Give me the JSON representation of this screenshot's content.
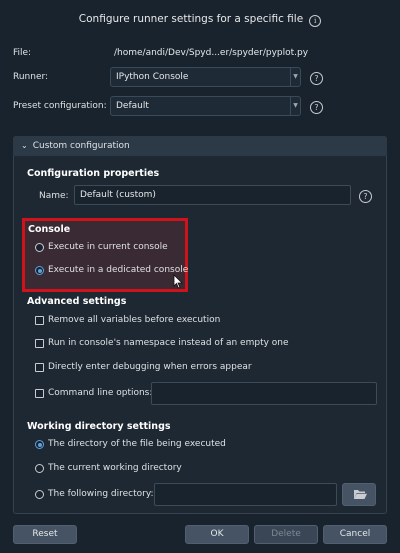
{
  "dialog": {
    "title": "Configure runner settings for a specific file"
  },
  "file": {
    "label": "File:",
    "value": "/home/andi/Dev/Spyd...er/spyder/pyplot.py"
  },
  "runner": {
    "label": "Runner:",
    "value": "IPython Console"
  },
  "preset": {
    "label": "Preset configuration:",
    "value": "Default"
  },
  "custom_config": {
    "header": "Custom configuration",
    "properties_title": "Configuration properties",
    "name_label": "Name:",
    "name_value": "Default (custom)"
  },
  "console": {
    "title": "Console",
    "options": [
      {
        "label": "Execute in current console",
        "selected": false
      },
      {
        "label": "Execute in a dedicated console",
        "selected": true
      }
    ]
  },
  "advanced": {
    "title": "Advanced settings",
    "options": [
      {
        "label": "Remove all variables before execution",
        "checked": false
      },
      {
        "label": "Run in console's namespace instead of an empty one",
        "checked": false
      },
      {
        "label": "Directly enter debugging when errors appear",
        "checked": false
      },
      {
        "label": "Command line options:",
        "checked": false
      }
    ],
    "command_line_value": ""
  },
  "working_dir": {
    "title": "Working directory settings",
    "options": [
      {
        "label": "The directory of the file being executed",
        "selected": true
      },
      {
        "label": "The current working directory",
        "selected": false
      },
      {
        "label": "The following directory:",
        "selected": false
      }
    ],
    "directory_value": ""
  },
  "buttons": {
    "reset": "Reset",
    "ok": "OK",
    "delete": "Delete",
    "cancel": "Cancel"
  },
  "colors": {
    "background": "#19232d",
    "highlight_border": "#d0121b",
    "accent": "#5fa2dd"
  }
}
